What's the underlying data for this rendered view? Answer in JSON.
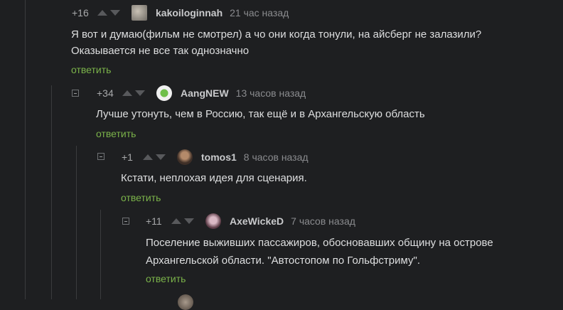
{
  "comments": [
    {
      "rating": "+16",
      "username": "kakoiloginnah",
      "time": "21 час назад",
      "text_lines": [
        "Я вот и думаю(фильм не смотрел) а чо они когда тонули, на айсберг не залазили?",
        "Оказывается не все так однозначно"
      ],
      "reply": "ответить",
      "collapse": false
    },
    {
      "rating": "+34",
      "username": "AangNEW",
      "time": "13 часов назад",
      "text_lines": [
        "Лучше утонуть, чем в Россию, так ещё и в Архангельскую область"
      ],
      "reply": "ответить",
      "collapse": true
    },
    {
      "rating": "+1",
      "username": "tomos1",
      "time": "8 часов назад",
      "text_lines": [
        "Кстати, неплохая идея для сценария."
      ],
      "reply": "ответить",
      "collapse": true
    },
    {
      "rating": "+11",
      "username": "AxeWickeD",
      "time": "7 часов назад",
      "text_lines": [
        "Поселение выживших пассажиров, обосновавших общину на острове",
        "Архангельской области. \"Автостопом по Гольфстриму\"."
      ],
      "reply": "ответить",
      "collapse": true
    }
  ],
  "colors": {
    "background": "#1e1f21",
    "reply_link": "#7bb34a",
    "username": "#c9cacc",
    "time": "#8a8b8e"
  }
}
